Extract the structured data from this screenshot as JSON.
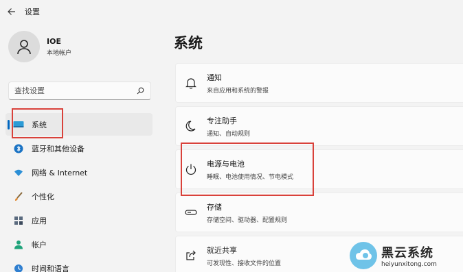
{
  "window": {
    "title": "设置",
    "back_icon": "back-arrow-icon"
  },
  "profile": {
    "name": "IOE",
    "account_type": "本地帐户",
    "avatar_icon": "person-icon"
  },
  "search": {
    "placeholder": "查找设置",
    "icon": "search-icon"
  },
  "sidebar": {
    "items": [
      {
        "label": "系统",
        "icon": "monitor-icon",
        "selected": true
      },
      {
        "label": "蓝牙和其他设备",
        "icon": "bluetooth-icon"
      },
      {
        "label": "网络 & Internet",
        "icon": "wifi-icon"
      },
      {
        "label": "个性化",
        "icon": "brush-icon"
      },
      {
        "label": "应用",
        "icon": "apps-icon"
      },
      {
        "label": "帐户",
        "icon": "person-icon"
      },
      {
        "label": "时间和语言",
        "icon": "clock-globe-icon"
      }
    ]
  },
  "main": {
    "title": "系统",
    "cards": [
      {
        "title": "通知",
        "subtitle": "来自应用和系统的警报",
        "icon": "bell-icon"
      },
      {
        "title": "专注助手",
        "subtitle": "通知、自动规则",
        "icon": "moon-icon"
      },
      {
        "title": "电源与电池",
        "subtitle": "睡眠、电池使用情况、节电模式",
        "icon": "power-icon"
      },
      {
        "title": "存储",
        "subtitle": "存储空间、驱动器、配置规则",
        "icon": "storage-icon"
      },
      {
        "title": "就近共享",
        "subtitle": "可发现性、接收文件的位置",
        "icon": "share-icon"
      }
    ]
  },
  "watermark": {
    "title": "黑云系统",
    "url": "heiyunxitong.com"
  },
  "colors": {
    "accent": "#0067c0",
    "highlight_box": "#d9413a",
    "background": "#f3f3f3",
    "card": "#fbfbfb"
  }
}
